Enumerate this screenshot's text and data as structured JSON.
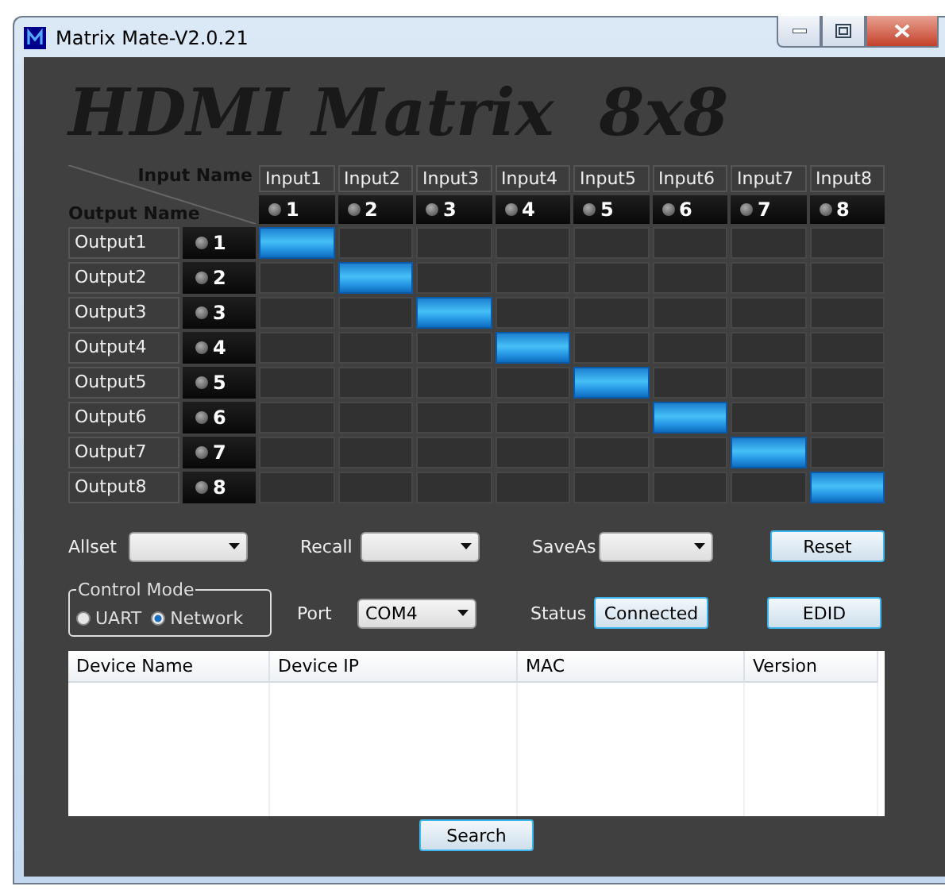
{
  "window": {
    "title": "Matrix Mate-V2.0.21"
  },
  "banner": "HDMI Matrix  8x8",
  "matrix": {
    "corner_top": "Input Name",
    "corner_bottom": "Output Name",
    "inputs": [
      {
        "name": "Input1",
        "number": "1"
      },
      {
        "name": "Input2",
        "number": "2"
      },
      {
        "name": "Input3",
        "number": "3"
      },
      {
        "name": "Input4",
        "number": "4"
      },
      {
        "name": "Input5",
        "number": "5"
      },
      {
        "name": "Input6",
        "number": "6"
      },
      {
        "name": "Input7",
        "number": "7"
      },
      {
        "name": "Input8",
        "number": "8"
      }
    ],
    "outputs": [
      {
        "name": "Output1",
        "number": "1",
        "cells": [
          {
            "selected": true
          },
          {
            "selected": false
          },
          {
            "selected": false
          },
          {
            "selected": false
          },
          {
            "selected": false
          },
          {
            "selected": false
          },
          {
            "selected": false
          },
          {
            "selected": false
          }
        ]
      },
      {
        "name": "Output2",
        "number": "2",
        "cells": [
          {
            "selected": false
          },
          {
            "selected": true
          },
          {
            "selected": false
          },
          {
            "selected": false
          },
          {
            "selected": false
          },
          {
            "selected": false
          },
          {
            "selected": false
          },
          {
            "selected": false
          }
        ]
      },
      {
        "name": "Output3",
        "number": "3",
        "cells": [
          {
            "selected": false
          },
          {
            "selected": false
          },
          {
            "selected": true
          },
          {
            "selected": false
          },
          {
            "selected": false
          },
          {
            "selected": false
          },
          {
            "selected": false
          },
          {
            "selected": false
          }
        ]
      },
      {
        "name": "Output4",
        "number": "4",
        "cells": [
          {
            "selected": false
          },
          {
            "selected": false
          },
          {
            "selected": false
          },
          {
            "selected": true
          },
          {
            "selected": false
          },
          {
            "selected": false
          },
          {
            "selected": false
          },
          {
            "selected": false
          }
        ]
      },
      {
        "name": "Output5",
        "number": "5",
        "cells": [
          {
            "selected": false
          },
          {
            "selected": false
          },
          {
            "selected": false
          },
          {
            "selected": false
          },
          {
            "selected": true
          },
          {
            "selected": false
          },
          {
            "selected": false
          },
          {
            "selected": false
          }
        ]
      },
      {
        "name": "Output6",
        "number": "6",
        "cells": [
          {
            "selected": false
          },
          {
            "selected": false
          },
          {
            "selected": false
          },
          {
            "selected": false
          },
          {
            "selected": false
          },
          {
            "selected": true
          },
          {
            "selected": false
          },
          {
            "selected": false
          }
        ]
      },
      {
        "name": "Output7",
        "number": "7",
        "cells": [
          {
            "selected": false
          },
          {
            "selected": false
          },
          {
            "selected": false
          },
          {
            "selected": false
          },
          {
            "selected": false
          },
          {
            "selected": false
          },
          {
            "selected": true
          },
          {
            "selected": false
          }
        ]
      },
      {
        "name": "Output8",
        "number": "8",
        "cells": [
          {
            "selected": false
          },
          {
            "selected": false
          },
          {
            "selected": false
          },
          {
            "selected": false
          },
          {
            "selected": false
          },
          {
            "selected": false
          },
          {
            "selected": false
          },
          {
            "selected": true
          }
        ]
      }
    ]
  },
  "allset": {
    "label": "Allset"
  },
  "recall": {
    "label": "Recall"
  },
  "saveas": {
    "label": "SaveAs"
  },
  "reset_button": "Reset",
  "control_mode": {
    "title": "Control Mode",
    "options": [
      {
        "label": "UART",
        "selected": false
      },
      {
        "label": "Network",
        "selected": true
      }
    ]
  },
  "port": {
    "label": "Port",
    "value": "COM4"
  },
  "status": {
    "label": "Status",
    "value": "Connected"
  },
  "edid_button": "EDID",
  "devices": {
    "columns": [
      "Device Name",
      "Device IP",
      "MAC",
      "Version"
    ]
  },
  "search_button": "Search"
}
